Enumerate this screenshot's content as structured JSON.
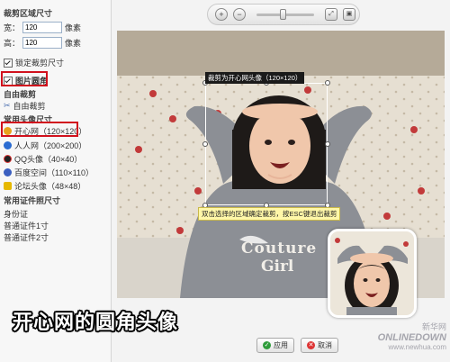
{
  "sidebar": {
    "crop_size_title": "裁剪区域尺寸",
    "width_label": "宽：",
    "width_value": "120",
    "width_unit": "像素",
    "height_label": "高：",
    "height_value": "120",
    "height_unit": "像素",
    "lock_label": "锁定裁剪尺寸",
    "rounded_label": "图片圆角",
    "free_crop_title": "自由裁剪",
    "free_crop_item": "自由裁剪",
    "avatar_title": "常用头像尺寸",
    "avatar_items": [
      {
        "label": "开心网（120×120）",
        "icon": "kaixin-icon",
        "color": "#e8a21b"
      },
      {
        "label": "人人网（200×200）",
        "icon": "renren-icon",
        "color": "#2a6bd1"
      },
      {
        "label": "QQ头像（40×40）",
        "icon": "qq-icon",
        "color": "#d33"
      },
      {
        "label": "百度空间（110×110）",
        "icon": "baidu-icon",
        "color": "#3b5fc0"
      },
      {
        "label": "论坛头像（48×48）",
        "icon": "forum-icon",
        "color": "#e6b800"
      }
    ],
    "id_photo_title": "常用证件照尺寸",
    "id_items": [
      "身份证",
      "普通证件1寸",
      "普通证件2寸"
    ]
  },
  "toolbar": {
    "zoom_in_icon": "zoom-in-icon",
    "zoom_out_icon": "zoom-out-icon",
    "fit_icon": "fit-window-icon",
    "actual_icon": "actual-size-icon"
  },
  "canvas": {
    "crop_tip": "裁剪为开心网头像（120×120）",
    "hint": "双击选择的区域确定裁剪，按ESC键退出裁剪",
    "shirt_text_1": "Couture",
    "shirt_text_2": "Girl"
  },
  "buttons": {
    "apply": "应用",
    "cancel": "取消"
  },
  "caption": "开心网的圆角头像",
  "watermark": {
    "site_cn": "新华网",
    "site_en": "ONLINEDOWN",
    "url": "www.newhua.com"
  },
  "colors": {
    "highlight": "#d1111d",
    "tip_bg": "#1a1a1a",
    "hint_bg": "#fff7a8"
  }
}
